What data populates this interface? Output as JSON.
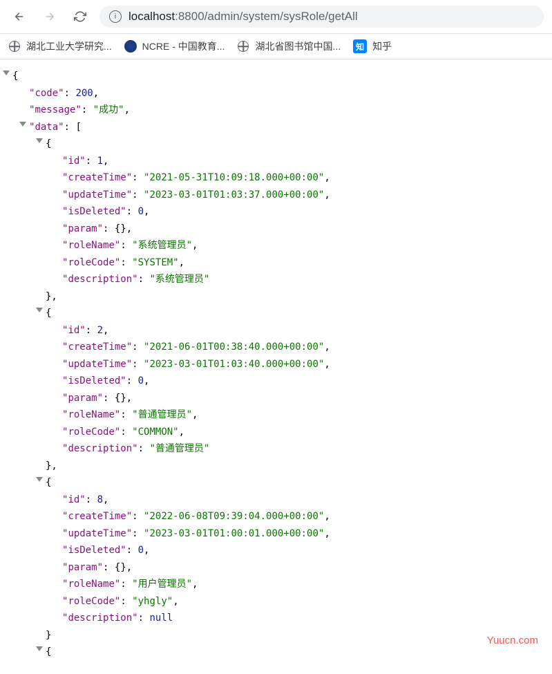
{
  "browser": {
    "url_host": "localhost",
    "url_port": ":8800",
    "url_path": "/admin/system/sysRole/getAll"
  },
  "bookmarks": [
    {
      "label": "湖北工业大学研究...",
      "icon": "globe"
    },
    {
      "label": "NCRE - 中国教育...",
      "icon": "ncre"
    },
    {
      "label": "湖北省图书馆中国...",
      "icon": "globe"
    },
    {
      "label": "知乎",
      "icon": "zhihu",
      "zhihu_glyph": "知"
    }
  ],
  "json": {
    "code": 200,
    "message": "成功",
    "data": [
      {
        "id": 1,
        "createTime": "2021-05-31T10:09:18.000+00:00",
        "updateTime": "2023-03-01T01:03:37.000+00:00",
        "isDeleted": 0,
        "param_display": "{}",
        "roleName": "系统管理员",
        "roleCode": "SYSTEM",
        "description": "系统管理员"
      },
      {
        "id": 2,
        "createTime": "2021-06-01T00:38:40.000+00:00",
        "updateTime": "2023-03-01T01:03:40.000+00:00",
        "isDeleted": 0,
        "param_display": "{}",
        "roleName": "普通管理员",
        "roleCode": "COMMON",
        "description": "普通管理员"
      },
      {
        "id": 8,
        "createTime": "2022-06-08T09:39:04.000+00:00",
        "updateTime": "2023-03-01T01:00:01.000+00:00",
        "isDeleted": 0,
        "param_display": "{}",
        "roleName": "用户管理员",
        "roleCode": "yhgly",
        "description": null
      }
    ]
  },
  "watermark": "Yuucn.com"
}
